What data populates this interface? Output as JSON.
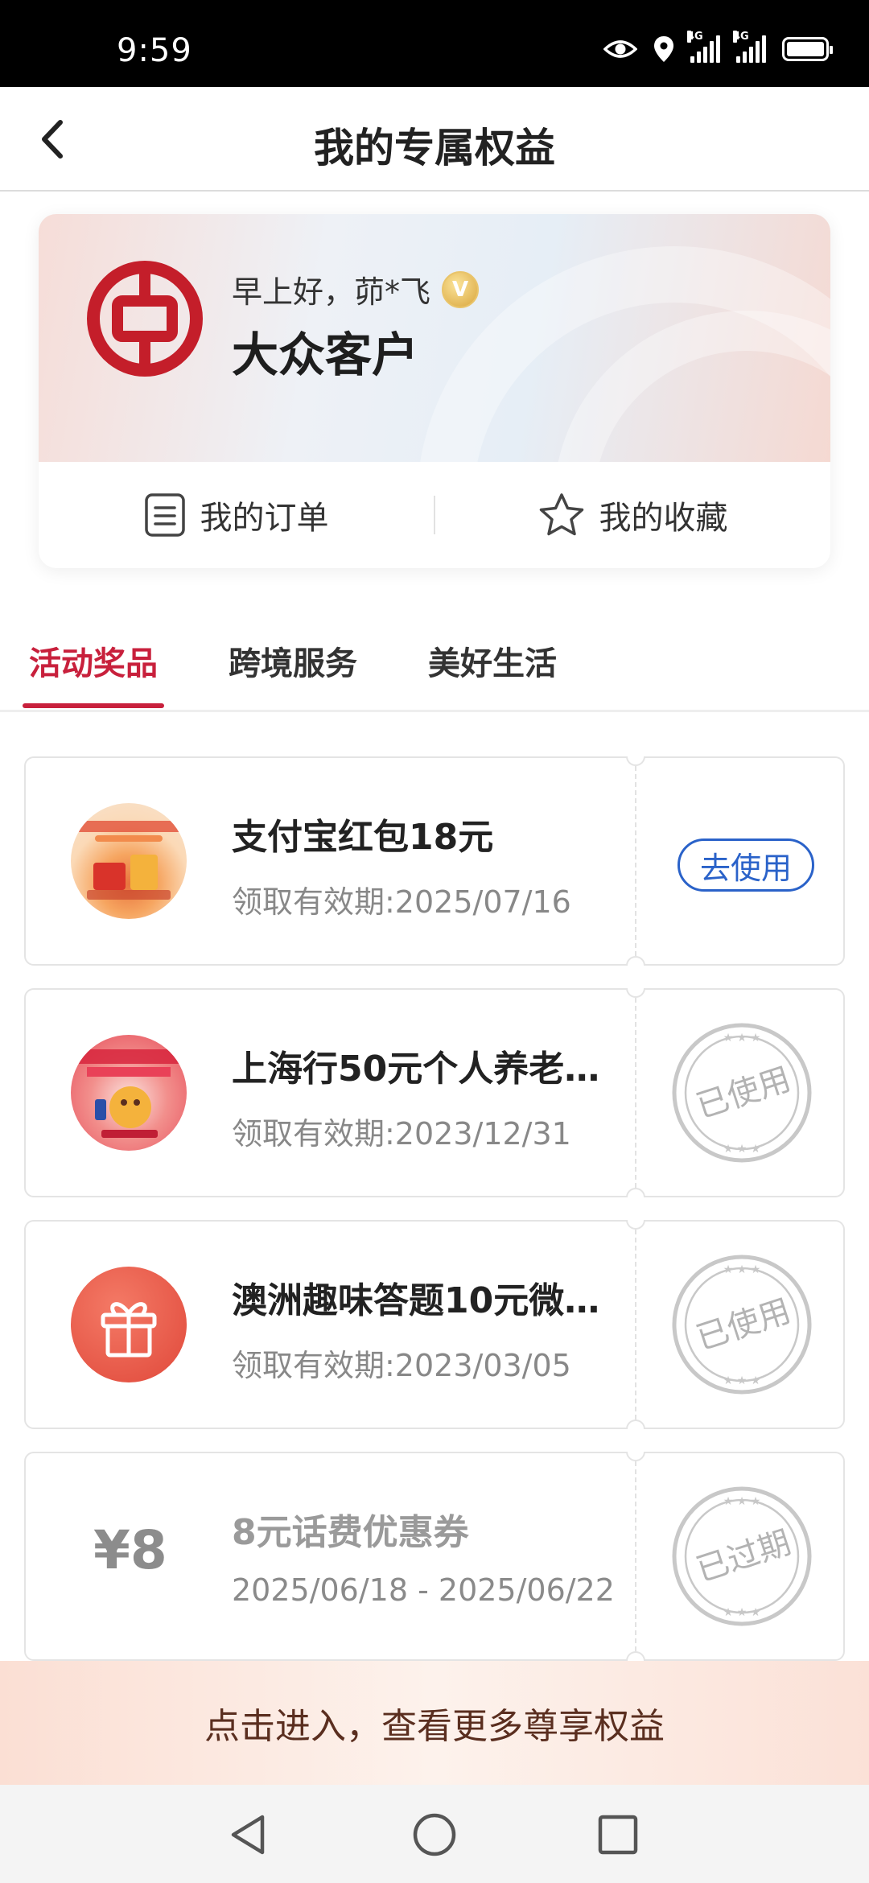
{
  "status_bar": {
    "time": "9:59",
    "net1": "4G",
    "net2": "4G"
  },
  "header": {
    "title": "我的专属权益"
  },
  "member": {
    "greeting": "早上好，茆*飞",
    "vip_letter": "V",
    "level": "大众客户",
    "orders_label": "我的订单",
    "favorites_label": "我的收藏"
  },
  "tabs": [
    {
      "label": "活动奖品",
      "active": true
    },
    {
      "label": "跨境服务",
      "active": false
    },
    {
      "label": "美好生活",
      "active": false
    }
  ],
  "coupons": [
    {
      "title": "支付宝红包18元",
      "date": "领取有效期:2025/07/16",
      "status": "去使用",
      "thumb": "alipay-redpacket-thumb"
    },
    {
      "title": "上海行50元个人养老…",
      "date": "领取有效期:2023/12/31",
      "status": "已使用",
      "thumb": "pension-thumb"
    },
    {
      "title": "澳洲趣味答题10元微…",
      "date": "领取有效期:2023/03/05",
      "status": "已使用",
      "thumb": "gift-icon"
    },
    {
      "title": "8元话费优惠券",
      "date": "2025/06/18 - 2025/06/22",
      "status": "已过期",
      "price": "¥8"
    }
  ],
  "promo": {
    "text": "点击进入，查看更多尊享权益"
  },
  "colors": {
    "accent_red": "#c8203c",
    "link_blue": "#2a62c9",
    "logo_red": "#c41e2a"
  },
  "icons": [
    "eye-icon",
    "location-icon",
    "signal-icon",
    "battery-icon",
    "back-arrow-icon",
    "order-list-icon",
    "star-icon",
    "nav-back-icon",
    "nav-home-icon",
    "nav-recents-icon"
  ]
}
